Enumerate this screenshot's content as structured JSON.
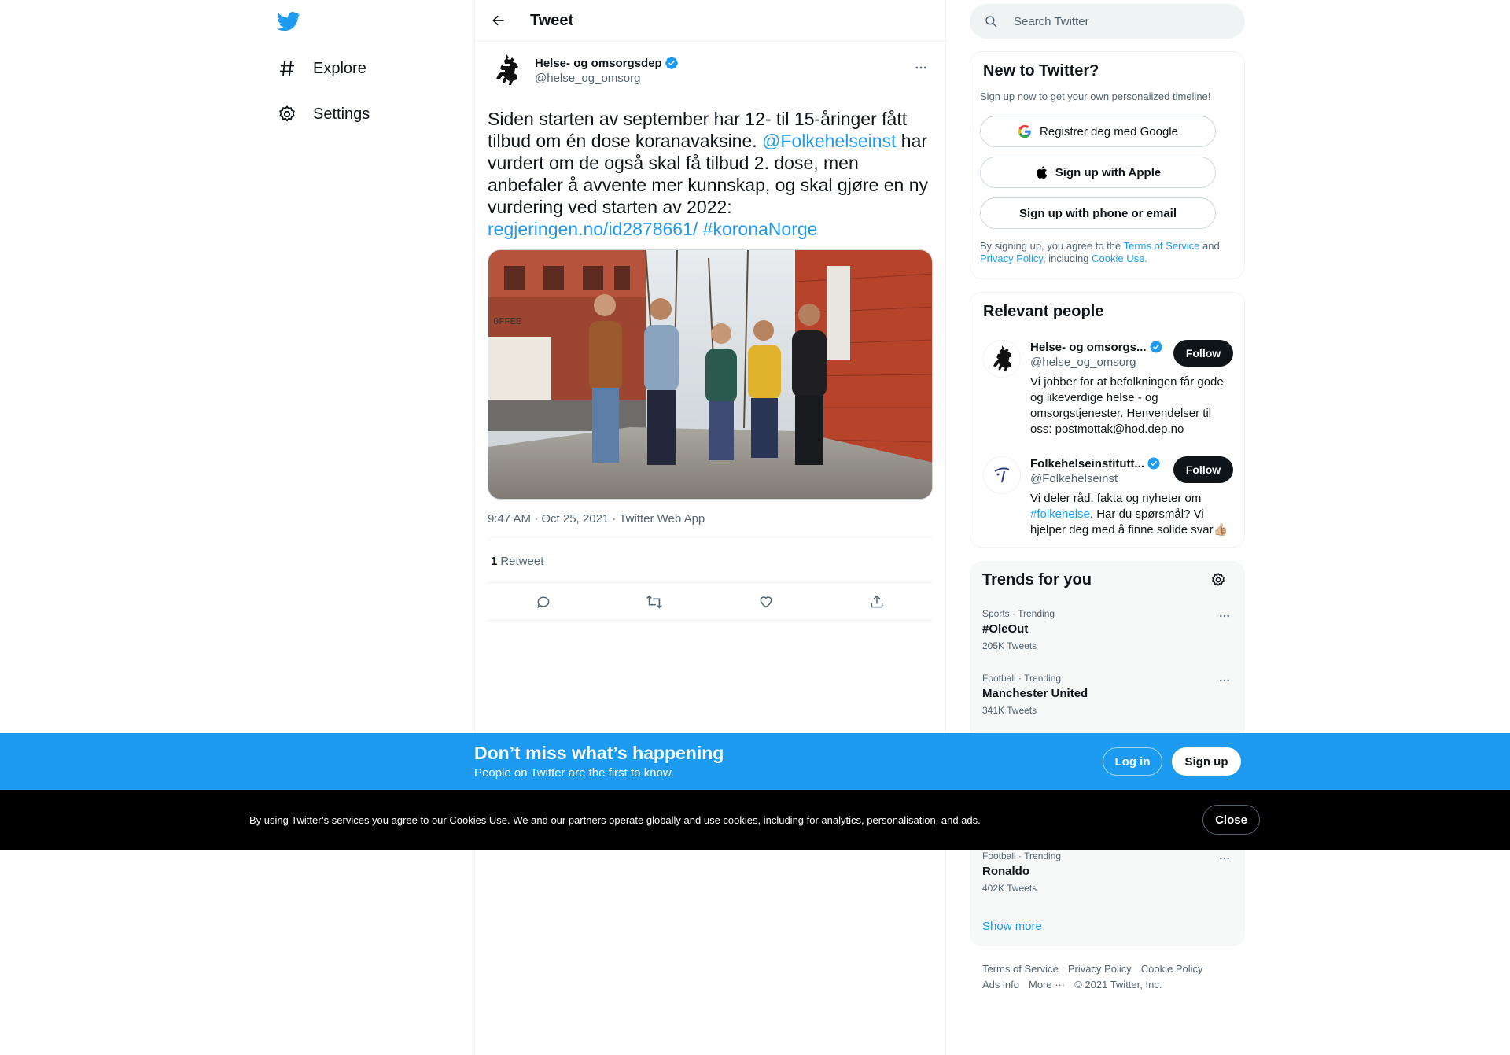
{
  "nav": {
    "items": [
      {
        "label": "Explore",
        "icon": "hashtag-icon"
      },
      {
        "label": "Settings",
        "icon": "gear-icon"
      }
    ]
  },
  "header": {
    "title": "Tweet"
  },
  "tweet": {
    "author_name": "Helse- og omsorgsdep",
    "author_handle": "@helse_og_omsorg",
    "text_1": "Siden starten av september har 12- til 15-åringer fått tilbud om én dose koranavaksine. ",
    "mention": "@Folkehelseinst",
    "text_2": "  har vurdert om de også skal få tilbud 2. dose, men anbefaler å avvente mer kunnskap, og skal gjøre en ny vurdering ved starten av 2022: ",
    "link": "regjeringen.no/id2878661/",
    "hashtag": "#koronaNorge",
    "meta": "9:47 AM · Oct 25, 2021 · Twitter Web App",
    "retweet_count": "1",
    "retweet_label": "Retweet"
  },
  "search": {
    "placeholder": "Search Twitter"
  },
  "new_to_twitter": {
    "title": "New to Twitter?",
    "subtitle": "Sign up now to get your own personalized timeline!",
    "google": "Registrer deg med Google",
    "apple": "Sign up with Apple",
    "phone": "Sign up with phone or email",
    "legal_1": "By signing up, you agree to the ",
    "terms": "Terms of Service",
    "legal_2": " and ",
    "privacy": "Privacy Policy",
    "legal_3": ", including ",
    "cookie": "Cookie Use."
  },
  "relevant_people": {
    "title": "Relevant people",
    "people": [
      {
        "name": "Helse- og omsorgs...",
        "handle": "@helse_og_omsorg",
        "bio": "Vi jobber for at befolkningen får gode og likeverdige helse - og omsorgstjenester. Henvendelser til oss: postmottak@hod.dep.no",
        "follow": "Follow"
      },
      {
        "name": "Folkehelseinstitutt...",
        "handle": "@Folkehelseinst",
        "bio_1": "Vi deler råd, fakta og nyheter om ",
        "bio_tag": "#folkehelse",
        "bio_2": ". Har du spørsmål? Vi hjelper deg med å finne solide svar👍🏼",
        "follow": "Follow"
      }
    ]
  },
  "trends": {
    "title": "Trends for you",
    "items": [
      {
        "category": "Sports · Trending",
        "name": "#OleOut",
        "count": "205K Tweets"
      },
      {
        "category": "Football · Trending",
        "name": "Manchester United",
        "count": "341K Tweets"
      },
      {
        "category": "Football · Trending",
        "name": "Ronaldo",
        "count": "402K Tweets"
      }
    ],
    "show_more": "Show more"
  },
  "footer": {
    "links": [
      "Terms of Service",
      "Privacy Policy",
      "Cookie Policy",
      "Ads info",
      "More ···",
      "© 2021 Twitter, Inc."
    ]
  },
  "signup_bar": {
    "heading": "Don’t miss what’s happening",
    "sub": "People on Twitter are the first to know.",
    "login": "Log in",
    "signup": "Sign up"
  },
  "cookie_bar": {
    "text": "By using Twitter’s services you agree to our Cookies Use. We and our partners operate globally and use cookies, including for analytics, personalisation, and ads.",
    "close": "Close"
  },
  "colors": {
    "accent": "#1d9bf0",
    "text": "#0f1419",
    "muted": "#536471",
    "cookie_bg": "#000000"
  }
}
